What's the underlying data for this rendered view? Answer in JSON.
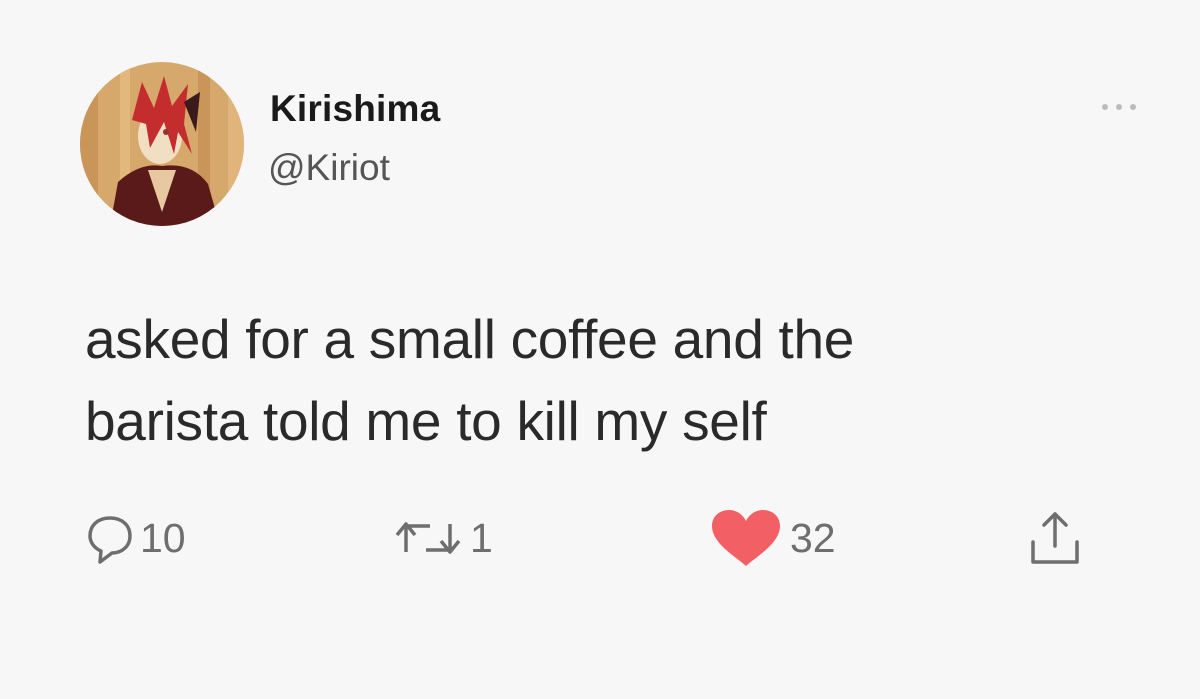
{
  "tweet": {
    "author": {
      "display_name": "Kirishima",
      "handle": "@Kiriot",
      "avatar_icon": "avatar-illustration"
    },
    "more_icon": "more-options-icon",
    "text_lines": [
      "asked for a small coffee and the",
      "barista told me to kill my self"
    ],
    "actions": {
      "reply": {
        "icon": "reply-icon",
        "count": "10"
      },
      "retweet": {
        "icon": "retweet-icon",
        "count": "1"
      },
      "like": {
        "icon": "heart-icon",
        "count": "32",
        "color": "#f25f64"
      },
      "share": {
        "icon": "share-icon"
      }
    }
  },
  "colors": {
    "background": "#f7f7f7",
    "text": "#2a2a2a",
    "secondary": "#6e6e6e",
    "like": "#f25f64"
  }
}
